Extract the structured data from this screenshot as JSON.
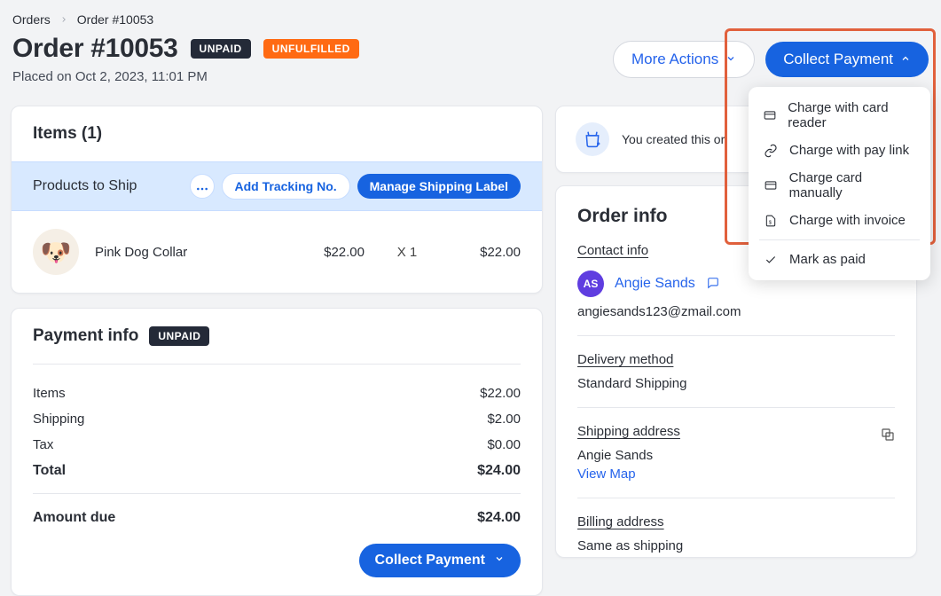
{
  "breadcrumb": {
    "root": "Orders",
    "current": "Order #10053"
  },
  "header": {
    "title": "Order #10053",
    "badge_unpaid": "UNPAID",
    "badge_unfulfilled": "UNFULFILLED",
    "placed": "Placed on Oct 2, 2023, 11:01 PM",
    "more_actions": "More Actions",
    "collect_payment": "Collect Payment"
  },
  "dropdown": {
    "items": [
      "Charge with card reader",
      "Charge with pay link",
      "Charge card manually",
      "Charge with invoice"
    ],
    "mark_as_paid": "Mark as paid"
  },
  "items_card": {
    "title": "Items (1)",
    "ship_label": "Products to Ship",
    "add_tracking": "Add Tracking No.",
    "manage_label": "Manage Shipping Label",
    "item": {
      "name": "Pink Dog Collar",
      "price": "$22.00",
      "qty": "X 1",
      "total": "$22.00"
    }
  },
  "payment_card": {
    "title": "Payment info",
    "badge": "UNPAID",
    "lines": {
      "items_label": "Items",
      "items_val": "$22.00",
      "shipping_label": "Shipping",
      "shipping_val": "$2.00",
      "tax_label": "Tax",
      "tax_val": "$0.00",
      "total_label": "Total",
      "total_val": "$24.00",
      "due_label": "Amount due",
      "due_val": "$24.00"
    },
    "collect_btn": "Collect Payment"
  },
  "activity": {
    "text": "You created this or"
  },
  "order_info": {
    "heading": "Order info",
    "contact_label": "Contact info",
    "avatar_initials": "AS",
    "contact_name": "Angie Sands",
    "contact_email": "angiesands123@zmail.com",
    "delivery_label": "Delivery method",
    "delivery_value": "Standard Shipping",
    "shipping_label": "Shipping address",
    "shipping_name": "Angie Sands",
    "view_map": "View Map",
    "billing_label": "Billing address",
    "billing_value": "Same as shipping"
  }
}
